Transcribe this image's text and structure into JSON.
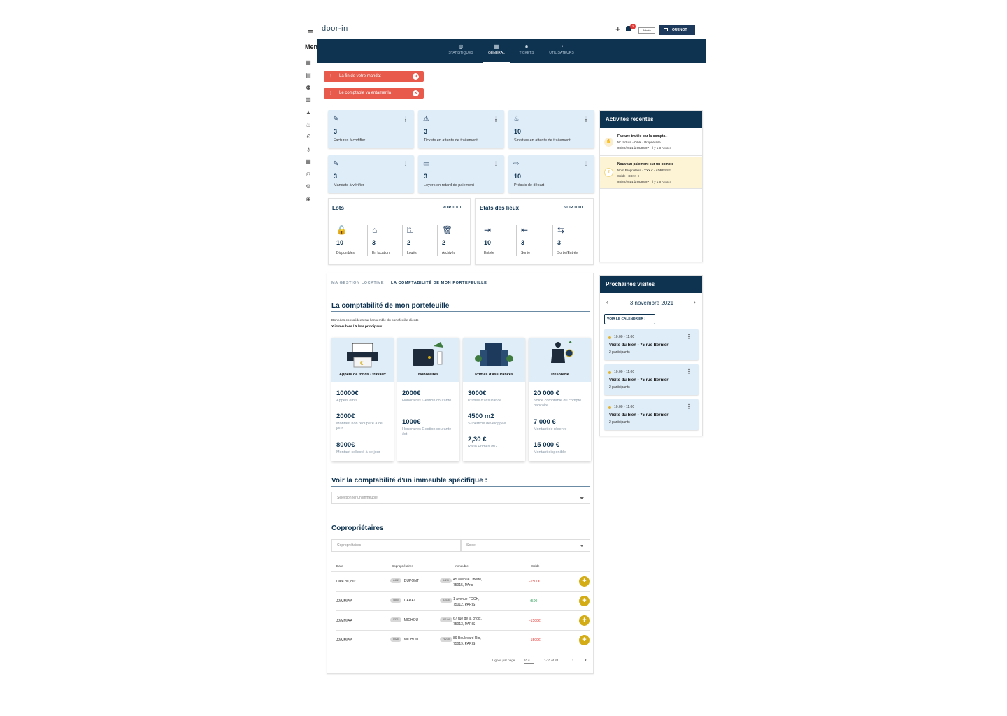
{
  "header": {
    "logo": "door-in",
    "plus": "+",
    "notif_count": "3",
    "role": "Admin",
    "account": "QUENOT"
  },
  "nav": [
    {
      "label": "STATISTIQUES",
      "icon": "globe-icon"
    },
    {
      "label": "GÉNÉRAL",
      "icon": "building-icon",
      "active": true
    },
    {
      "label": "TICKETS",
      "icon": "alert-icon"
    },
    {
      "label": "UTILISATEURS",
      "icon": "users-icon"
    }
  ],
  "sidebar": {
    "label": "Men",
    "icons": [
      "dashboard-icon",
      "contacts-icon",
      "people-icon",
      "buildings-icon",
      "warning-icon",
      "fire-icon",
      "euro-icon",
      "key-icon",
      "office-icon",
      "group-icon",
      "settings-icon",
      "account-icon"
    ]
  },
  "alerts": [
    "La fin de votre mandat",
    "Le comptable va entamer la"
  ],
  "kpis": [
    {
      "value": "3",
      "label": "Factures à codifier",
      "icon": "invoice-icon"
    },
    {
      "value": "3",
      "label": "Tickets en attente de traitement",
      "icon": "warning-icon"
    },
    {
      "value": "10",
      "label": "Sinistres en attente de traitement",
      "icon": "fire-icon"
    },
    {
      "value": "3",
      "label": "Mandats à vérifier",
      "icon": "contract-icon"
    },
    {
      "value": "3",
      "label": "Loyers  en retard de paiement",
      "icon": "card-icon"
    },
    {
      "value": "10",
      "label": "Préavis  de départ",
      "icon": "exit-door-icon"
    }
  ],
  "lots": {
    "title": "Lots",
    "voir": "VOIR TOUT",
    "items": [
      {
        "value": "10",
        "label": "Disponibles",
        "icon": "lock-icon",
        "glyph": "🔓"
      },
      {
        "value": "3",
        "label": "En location",
        "icon": "house-icon",
        "glyph": "⌂"
      },
      {
        "value": "2",
        "label": "Loués",
        "icon": "key-icon",
        "glyph": "⚿"
      },
      {
        "value": "2",
        "label": "Archivés",
        "icon": "trash-icon",
        "glyph": "🗑"
      }
    ]
  },
  "etats": {
    "title": "Etats des lieux",
    "voir": "VOIR TOUT",
    "items": [
      {
        "value": "10",
        "label": "Entrée",
        "icon": "login-icon",
        "glyph": "⇥"
      },
      {
        "value": "3",
        "label": "Sortie",
        "icon": "logout-icon",
        "glyph": "⇤"
      },
      {
        "value": "3",
        "label": "Sortie/Entrée",
        "icon": "swap-icon",
        "glyph": "⇆"
      }
    ]
  },
  "activites": {
    "title": "Activités récentes",
    "items": [
      {
        "title": "Facture traitée par la compta  -",
        "line1": "N° facture - Cible - Propriétaire",
        "line2": "08/09/2021 à 09/00/07 - il y a 3 heures"
      },
      {
        "title": "Nouveau paiement sur un compte",
        "line1": "Nom Propriétaire - XXX € - ADRESSE",
        "line2": "Solde : XXXX €",
        "line3": "08/09/2021 à 09/00/07 - il y a 3 heures"
      }
    ]
  },
  "visites": {
    "title": "Prochaines visites",
    "date": "3 novembre 2021",
    "calendar_btn": "VOIR LE CALENDRIER",
    "items": [
      {
        "time": "10:00 - 11:00",
        "name": "Visite du bien - 75 rue Bernier",
        "participants": "2 participants"
      },
      {
        "time": "10:00 - 11:00",
        "name": "Visite du bien - 75 rue Bernier",
        "participants": "2 participants"
      },
      {
        "time": "10:00 - 11:00",
        "name": "Visite du bien - 75 rue Bernier",
        "participants": "2 participants"
      }
    ]
  },
  "tabs": [
    "MA GESTION LOCATIVE",
    "LA COMPTABILITÉ DE MON PORTEFEUILLE"
  ],
  "compta": {
    "title": "La comptabilité de mon portefeuille",
    "desc1": "Données consolidées sur l'ensemble du portefeuille clients :",
    "desc2": "X immeubles / X lots principaux",
    "cards": [
      {
        "title": "Appels de fonds / travaux",
        "rows": [
          {
            "v": "10000€",
            "l": "Appels émis"
          },
          {
            "v": "2000€",
            "l": "Montant non récupéré à ce jour"
          },
          {
            "v": "8000€",
            "l": "Montant collecté à ce jour"
          }
        ]
      },
      {
        "title": "Honoraires",
        "rows": [
          {
            "v": "2000€",
            "l": "Honoraires Gestion courante"
          },
          {
            "v": "1000€",
            "l": "Honoraires Gestion courante /lot"
          }
        ]
      },
      {
        "title": "Primes d'assurances",
        "rows": [
          {
            "v": "3000€",
            "l": "Primes d'assurance"
          },
          {
            "v": "4500 m2",
            "l": "Superficie développée"
          },
          {
            "v": "2,30 €",
            "l": "Ratio Primes /m2"
          }
        ]
      },
      {
        "title": "Trésorerie",
        "rows": [
          {
            "v": "20 000 €",
            "l": "Solde comptable du compte bancaire"
          },
          {
            "v": "7 000 €",
            "l": "Montant de réserve"
          },
          {
            "v": "15 000 €",
            "l": "Montant disponible"
          }
        ]
      }
    ]
  },
  "immeuble": {
    "title": "Voir la comptabilité d'un immeuble spécifique :",
    "placeholder": "Sélectionner un immeuble"
  },
  "copro": {
    "title": "Copropriétaires",
    "filter1": "Copropriétaires",
    "filter2": "Solde",
    "headers": [
      "Date",
      "Copropriétaires",
      "Immeuble",
      "Solde"
    ],
    "rows": [
      {
        "date": "Date du jour",
        "id": "#402",
        "name": "DUPONT",
        "imm": "8420I",
        "addr1": "45 avenue Liberté,",
        "addr2": "75015, PAris",
        "solde": "-1500€",
        "neg": true
      },
      {
        "date": "JJ/MM/AA",
        "id": "4850",
        "name": "CARAT",
        "imm": "87475",
        "addr1": "1 avenue FOCH,",
        "addr2": "75012, PARIS",
        "solde": "+500",
        "neg": false
      },
      {
        "date": "JJ/MM/AA",
        "id": "0321",
        "name": "MICHOU",
        "imm": "9014d",
        "addr1": "67 rue de la choix,",
        "addr2": "75013, PARIS",
        "solde": "-1500€",
        "neg": true
      },
      {
        "date": "JJ/MM/AA",
        "id": "#528",
        "name": "MICHOU",
        "imm": "7823d",
        "addr1": "89 Boulevard Rio,",
        "addr2": "75019, PARIS",
        "solde": "-1500€",
        "neg": true
      }
    ],
    "rows_per_page_label": "Lignes par page",
    "rows_per_page": "10",
    "range": "1-10 of 83"
  }
}
